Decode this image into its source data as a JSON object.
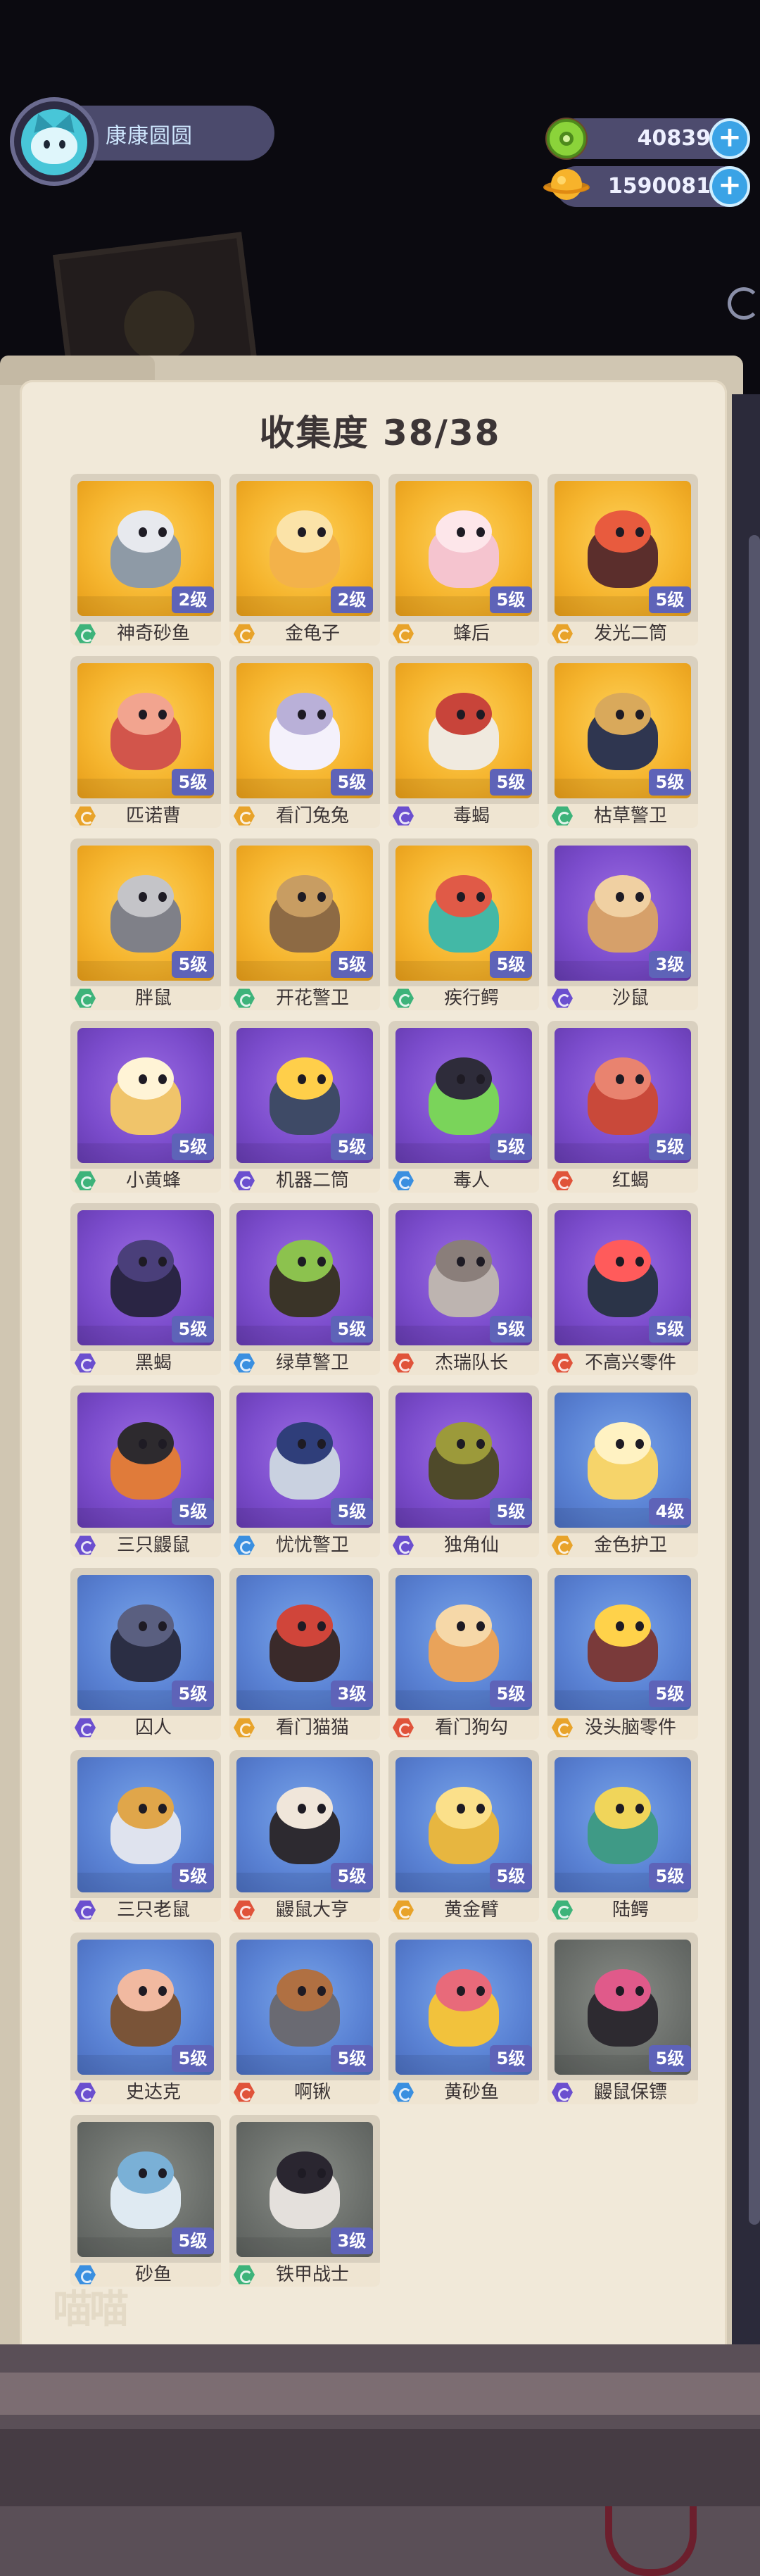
{
  "hud": {
    "player_name": "康康圆圆",
    "currency_gear": "40839",
    "currency_planet": "1590081",
    "plus_symbol": "+"
  },
  "collection": {
    "title": "收集度 38/38"
  },
  "watermark": "喵喵",
  "colors": {
    "rarity_gold": "#f5b42d",
    "rarity_purple": "#7b4ccc",
    "rarity_blue": "#5a82d4",
    "rarity_gray": "#6c706c",
    "level_badge": "#5e63b8",
    "element_green": "#3db37a",
    "element_gold": "#e8a32a",
    "element_purple": "#6b4fcf",
    "element_blue": "#3a8fe0",
    "element_red": "#e0533a"
  },
  "cards": [
    {
      "name": "神奇砂鱼",
      "level": "2级",
      "rarity": "gold",
      "element": "green",
      "icon": "sandfish-king-icon",
      "c1": "#8e9aa6",
      "c2": "#e7e9ee"
    },
    {
      "name": "金龟子",
      "level": "2级",
      "rarity": "gold",
      "element": "gold",
      "icon": "golden-beetle-icon",
      "c1": "#f3b24a",
      "c2": "#fbe3a8"
    },
    {
      "name": "蜂后",
      "level": "5级",
      "rarity": "gold",
      "element": "gold",
      "icon": "queen-bee-icon",
      "c1": "#f5c4cf",
      "c2": "#fde6ea"
    },
    {
      "name": "发光二筒",
      "level": "5级",
      "rarity": "gold",
      "element": "gold",
      "icon": "glowing-robot-icon",
      "c1": "#5b2e2c",
      "c2": "#e85b3e"
    },
    {
      "name": "匹诺曹",
      "level": "5级",
      "rarity": "gold",
      "element": "gold",
      "icon": "pinocchio-icon",
      "c1": "#d2554b",
      "c2": "#f2a48f"
    },
    {
      "name": "看门兔兔",
      "level": "5级",
      "rarity": "gold",
      "element": "gold",
      "icon": "guard-bunny-icon",
      "c1": "#f4f1fb",
      "c2": "#b9b0d8"
    },
    {
      "name": "毒蝎",
      "level": "5级",
      "rarity": "gold",
      "element": "purple",
      "icon": "poison-scorpion-icon",
      "c1": "#f0eadf",
      "c2": "#c8443a"
    },
    {
      "name": "枯草警卫",
      "level": "5级",
      "rarity": "gold",
      "element": "green",
      "icon": "hay-guard-icon",
      "c1": "#2f3650",
      "c2": "#d9a95b"
    },
    {
      "name": "胖鼠",
      "level": "5级",
      "rarity": "gold",
      "element": "green",
      "icon": "fat-rat-icon",
      "c1": "#7f8088",
      "c2": "#c4c4c8"
    },
    {
      "name": "开花警卫",
      "level": "5级",
      "rarity": "gold",
      "element": "green",
      "icon": "blossom-guard-icon",
      "c1": "#8d6a44",
      "c2": "#c89d62"
    },
    {
      "name": "疾行鳄",
      "level": "5级",
      "rarity": "gold",
      "element": "green",
      "icon": "swift-croc-icon",
      "c1": "#43b8a6",
      "c2": "#e05a47"
    },
    {
      "name": "沙鼠",
      "level": "3级",
      "rarity": "purple",
      "element": "purple",
      "icon": "sand-rat-icon",
      "c1": "#d6a06a",
      "c2": "#f0d0a2"
    },
    {
      "name": "小黄蜂",
      "level": "5级",
      "rarity": "purple",
      "element": "green",
      "icon": "little-wasp-icon",
      "c1": "#f0c46a",
      "c2": "#fff4d6"
    },
    {
      "name": "机器二筒",
      "level": "5级",
      "rarity": "purple",
      "element": "purple",
      "icon": "robot-bot-icon",
      "c1": "#3e4a66",
      "c2": "#ffcf4a"
    },
    {
      "name": "毒人",
      "level": "5级",
      "rarity": "purple",
      "element": "blue",
      "icon": "poison-man-icon",
      "c1": "#7ad45a",
      "c2": "#2e2c3a"
    },
    {
      "name": "红蝎",
      "level": "5级",
      "rarity": "purple",
      "element": "red",
      "icon": "red-scorpion-icon",
      "c1": "#c9493a",
      "c2": "#e9836f"
    },
    {
      "name": "黑蝎",
      "level": "5级",
      "rarity": "purple",
      "element": "purple",
      "icon": "black-scorpion-icon",
      "c1": "#2a2544",
      "c2": "#4a3f7a"
    },
    {
      "name": "绿草警卫",
      "level": "5级",
      "rarity": "purple",
      "element": "blue",
      "icon": "grass-guard-icon",
      "c1": "#3a3428",
      "c2": "#8cc24e"
    },
    {
      "name": "杰瑞队长",
      "level": "5级",
      "rarity": "purple",
      "element": "red",
      "icon": "captain-jerry-icon",
      "c1": "#bdb4b0",
      "c2": "#8a7e7a"
    },
    {
      "name": "不高兴零件",
      "level": "5级",
      "rarity": "purple",
      "element": "red",
      "icon": "grumpy-part-icon",
      "c1": "#2b3448",
      "c2": "#ff5b5b"
    },
    {
      "name": "三只鼹鼠",
      "level": "5级",
      "rarity": "purple",
      "element": "purple",
      "icon": "three-moles-icon",
      "c1": "#e07b3a",
      "c2": "#2d2a2e"
    },
    {
      "name": "忧忧警卫",
      "level": "5级",
      "rarity": "purple",
      "element": "blue",
      "icon": "worried-guard-icon",
      "c1": "#c9d1e0",
      "c2": "#2f3e7a"
    },
    {
      "name": "独角仙",
      "level": "5级",
      "rarity": "purple",
      "element": "purple",
      "icon": "rhino-beetle-icon",
      "c1": "#4f4a2a",
      "c2": "#9c9a3a"
    },
    {
      "name": "金色护卫",
      "level": "4级",
      "rarity": "blue",
      "element": "gold",
      "icon": "golden-guard-icon",
      "c1": "#f6d46a",
      "c2": "#fff2c2"
    },
    {
      "name": "囚人",
      "level": "5级",
      "rarity": "blue",
      "element": "purple",
      "icon": "prisoner-icon",
      "c1": "#2b2e44",
      "c2": "#5a5f80"
    },
    {
      "name": "看门猫猫",
      "level": "3级",
      "rarity": "blue",
      "element": "gold",
      "icon": "guard-cat-icon",
      "c1": "#3a2a2a",
      "c2": "#d0453a"
    },
    {
      "name": "看门狗勾",
      "level": "5级",
      "rarity": "blue",
      "element": "red",
      "icon": "guard-dog-icon",
      "c1": "#e9a35a",
      "c2": "#f6d8a8"
    },
    {
      "name": "没头脑零件",
      "level": "5级",
      "rarity": "blue",
      "element": "gold",
      "icon": "brainless-part-icon",
      "c1": "#7a3a3a",
      "c2": "#ffd24a"
    },
    {
      "name": "三只老鼠",
      "level": "5级",
      "rarity": "blue",
      "element": "purple",
      "icon": "three-mice-icon",
      "c1": "#dfe3ee",
      "c2": "#e0a64a"
    },
    {
      "name": "鼹鼠大亨",
      "level": "5级",
      "rarity": "blue",
      "element": "red",
      "icon": "mole-tycoon-icon",
      "c1": "#2d2a30",
      "c2": "#f0e6da"
    },
    {
      "name": "黄金臂",
      "level": "5级",
      "rarity": "blue",
      "element": "gold",
      "icon": "golden-arm-icon",
      "c1": "#e7b640",
      "c2": "#fbe08a"
    },
    {
      "name": "陆鳄",
      "level": "5级",
      "rarity": "blue",
      "element": "green",
      "icon": "land-croc-icon",
      "c1": "#3f9a86",
      "c2": "#f0d55a"
    },
    {
      "name": "史达克",
      "level": "5级",
      "rarity": "blue",
      "element": "purple",
      "icon": "stark-icon",
      "c1": "#7a5438",
      "c2": "#f1b9a0"
    },
    {
      "name": "啊锹",
      "level": "5级",
      "rarity": "blue",
      "element": "red",
      "icon": "pickaxe-icon",
      "c1": "#6a6a72",
      "c2": "#b07042"
    },
    {
      "name": "黄砂鱼",
      "level": "5级",
      "rarity": "blue",
      "element": "blue",
      "icon": "yellow-sandfish-icon",
      "c1": "#f2c23c",
      "c2": "#e86a7a"
    },
    {
      "name": "鼹鼠保镖",
      "level": "5级",
      "rarity": "gray",
      "element": "purple",
      "icon": "mole-bodyguard-icon",
      "c1": "#2d2a30",
      "c2": "#e05a8a"
    },
    {
      "name": "砂鱼",
      "level": "5级",
      "rarity": "gray",
      "element": "blue",
      "icon": "sandfish-icon",
      "c1": "#dfeaf2",
      "c2": "#7ab0d6"
    },
    {
      "name": "铁甲战士",
      "level": "3级",
      "rarity": "gray",
      "element": "green",
      "icon": "armored-warrior-icon",
      "c1": "#e4e0dc",
      "c2": "#2a2630"
    }
  ]
}
